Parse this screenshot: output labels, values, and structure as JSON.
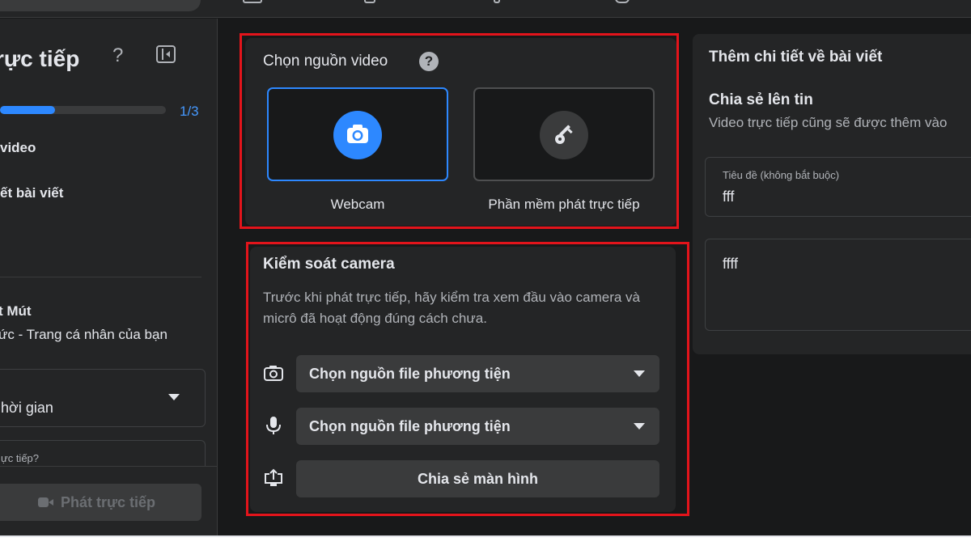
{
  "sidebar": {
    "title": "rực tiếp",
    "help_glyph": "?",
    "progress_fraction": 0.333,
    "progress_label": "1/3",
    "steps": [
      "video",
      "ết bài viết"
    ],
    "owner": {
      "name": "t Mút",
      "subtitle": "ức - Trang cá nhân của bạn"
    },
    "dropdown_value": "hời gian",
    "dropdown2_label": "ực tiếp?",
    "go_live_label": "Phát trực tiếp"
  },
  "video_source": {
    "title": "Chọn nguồn video",
    "help_glyph": "?",
    "options": [
      {
        "label": "Webcam",
        "icon": "camera-icon",
        "selected": true
      },
      {
        "label": "Phần mềm phát trực tiếp",
        "icon": "key-icon",
        "selected": false
      }
    ]
  },
  "camera_control": {
    "title": "Kiểm soát camera",
    "description": "Trước khi phát trực tiếp, hãy kiểm tra xem đầu vào camera và micrô đã hoạt động đúng cách chưa.",
    "camera_select": "Chọn nguồn file phương tiện",
    "mic_select": "Chọn nguồn file phương tiện",
    "share_screen": "Chia sẻ màn hình"
  },
  "post_details": {
    "title": "Thêm chi tiết về bài viết",
    "share_story": "Chia sẻ lên tin",
    "share_story_desc": "Video trực tiếp cũng sẽ được thêm vào",
    "title_field": {
      "label": "Tiêu đề (không bắt buộc)",
      "value": "fff"
    },
    "description_value": "ffff"
  },
  "colors": {
    "accent": "#2d88ff",
    "highlight": "#e3141b",
    "background": "#18191a",
    "card": "#242526"
  }
}
